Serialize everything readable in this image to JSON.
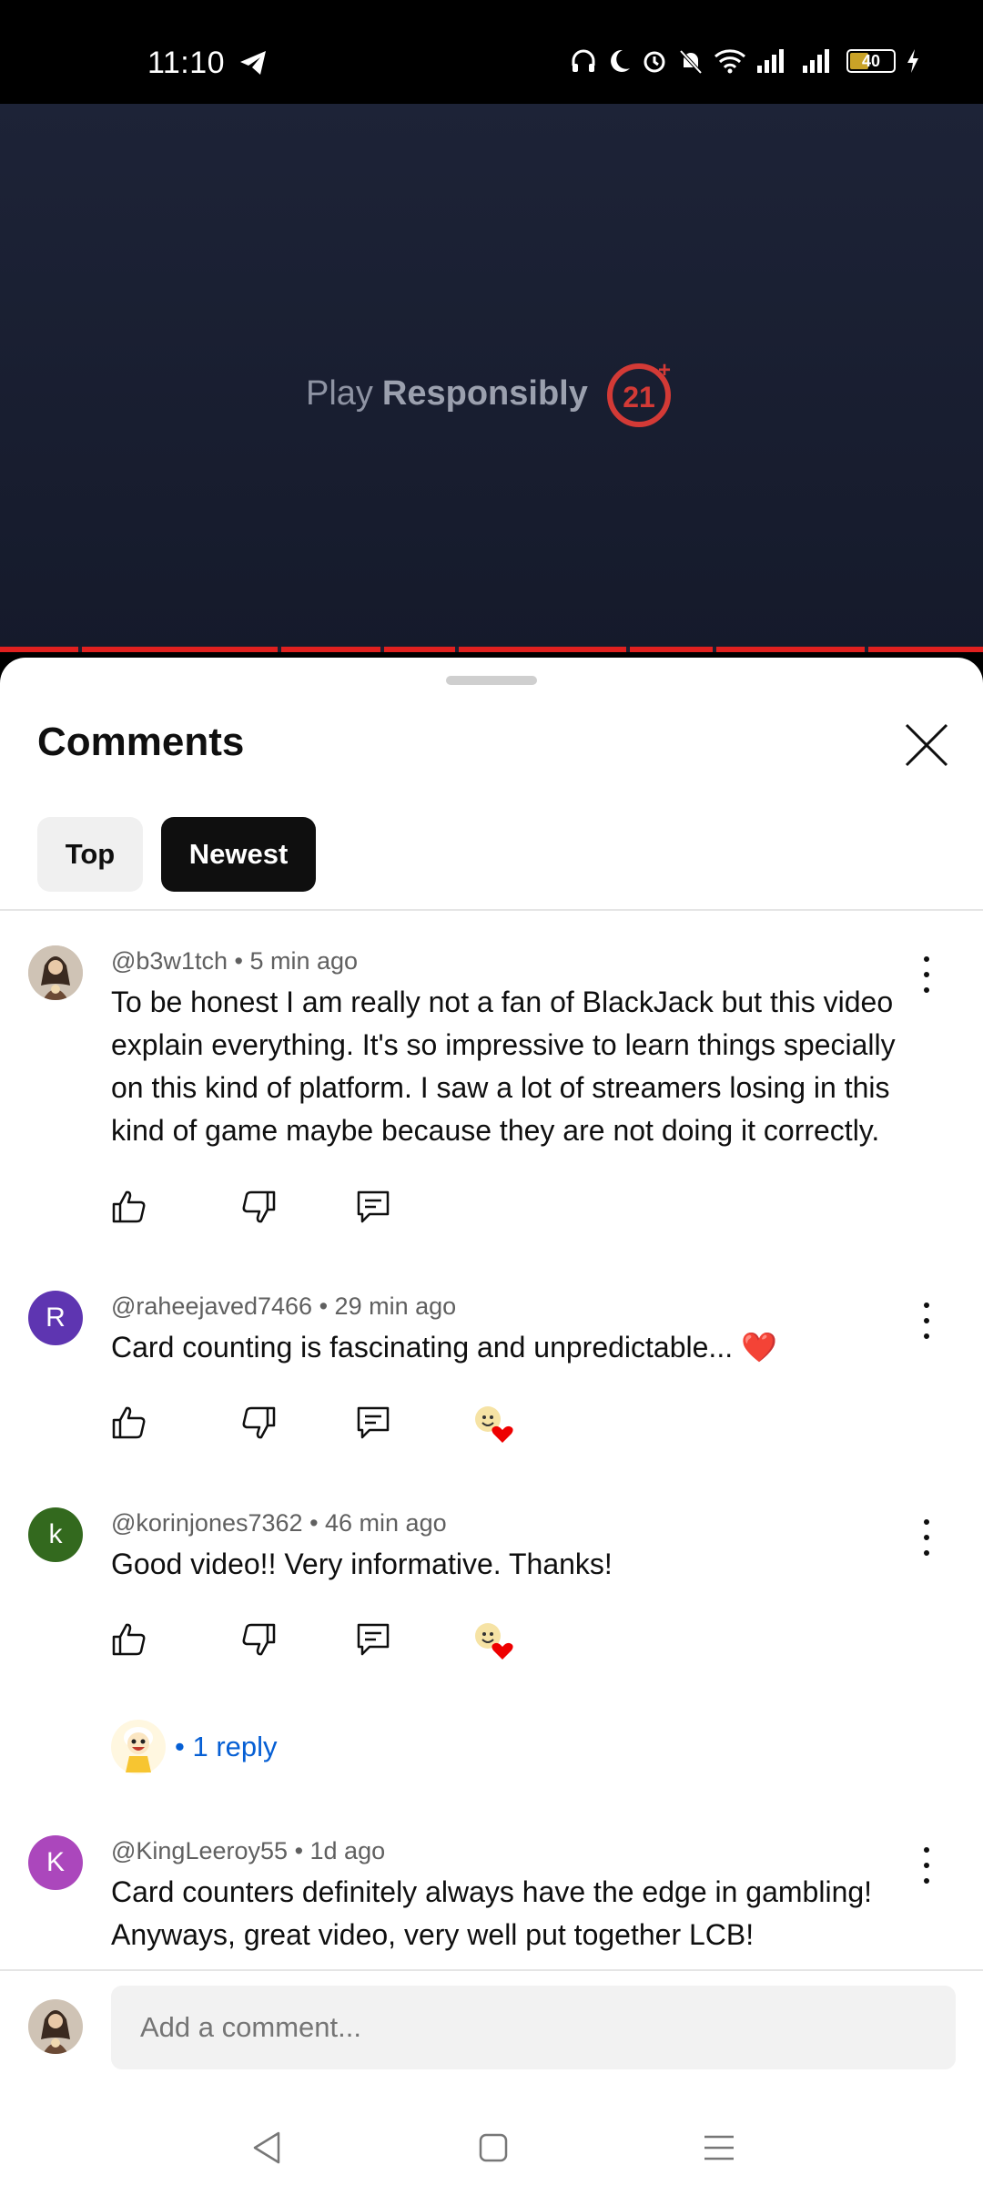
{
  "status_bar": {
    "time": "11:10",
    "battery": "40"
  },
  "video": {
    "text_light": "Play",
    "text_bold": "Responsibly",
    "age_badge": "21+"
  },
  "comments_sheet": {
    "title": "Comments",
    "filters": [
      {
        "label": "Top"
      },
      {
        "label": "Newest",
        "selected": true
      }
    ],
    "comments": [
      {
        "handle": "@b3w1tch",
        "time": "• 5 min ago",
        "text": "To be honest I am really not a fan of BlackJack but this video explain everything. It's so impressive to learn things specially on this kind of platform. I saw a lot of streamers losing in this kind of game maybe because they are not doing it correctly.",
        "avatar": "photo"
      },
      {
        "handle": "@raheejaved7466",
        "time": "• 29 min ago",
        "text": "Card counting is fascinating and unpredictable... ❤️",
        "avatar": "R",
        "avatar_color": "#5e35b1",
        "creator_heart": true
      },
      {
        "handle": "@korinjones7362",
        "time": "• 46 min ago",
        "text": "Good video!! Very informative. Thanks!",
        "avatar": "k",
        "avatar_color": "#33691e",
        "creator_heart": true,
        "replies_label": "• 1 reply"
      },
      {
        "handle": "@KingLeeroy55",
        "time": "• 1d ago",
        "text": "Card counters definitely always have the edge in gambling! Anyways, great video, very well put together LCB!",
        "avatar": "K",
        "avatar_color": "#ab47bc"
      }
    ],
    "composer": {
      "placeholder": "Add a comment..."
    }
  },
  "colors": {
    "accent_red": "#e0201f",
    "link_blue": "#065fd4"
  }
}
